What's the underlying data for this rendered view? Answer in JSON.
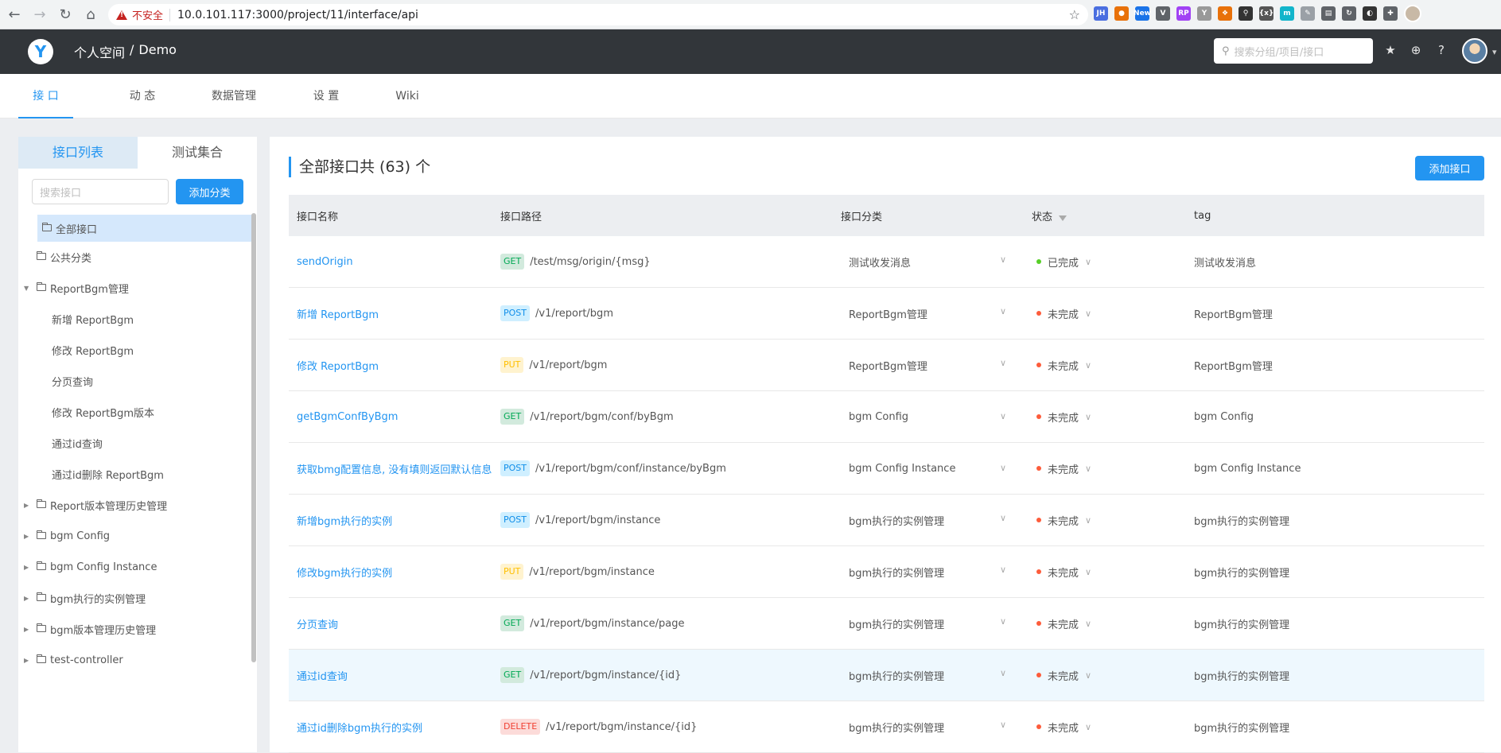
{
  "browser": {
    "insecure_label": "不安全",
    "url": "10.0.101.117:3000/project/11/interface/api",
    "extensions": [
      "JH",
      "●",
      "New",
      "V",
      "RP",
      "Y",
      "❖",
      "⚲",
      "{x}",
      "m",
      "✎",
      "▤",
      "↻",
      "◐",
      "✚"
    ]
  },
  "header": {
    "breadcrumb_space": "个人空间",
    "breadcrumb_sep": "/",
    "breadcrumb_project": "Demo",
    "search_placeholder": "搜索分组/项目/接口"
  },
  "subnav": {
    "tabs": [
      "接 口",
      "动 态",
      "数据管理",
      "设 置",
      "Wiki"
    ]
  },
  "left": {
    "tab_list": "接口列表",
    "tab_test": "测试集合",
    "search_placeholder": "搜索接口",
    "add_category": "添加分类",
    "tree": [
      {
        "label": "全部接口",
        "type": "folder",
        "selected": true
      },
      {
        "label": "公共分类",
        "type": "folder"
      },
      {
        "label": "ReportBgm管理",
        "type": "folder",
        "expanded": true
      },
      {
        "label": "新增 ReportBgm",
        "type": "item"
      },
      {
        "label": "修改 ReportBgm",
        "type": "item"
      },
      {
        "label": "分页查询",
        "type": "item"
      },
      {
        "label": "修改 ReportBgm版本",
        "type": "item"
      },
      {
        "label": "通过id查询",
        "type": "item"
      },
      {
        "label": "通过id删除 ReportBgm",
        "type": "item"
      },
      {
        "label": "Report版本管理历史管理",
        "type": "folder",
        "collapsed": true
      },
      {
        "label": "bgm Config",
        "type": "folder",
        "collapsed": true
      },
      {
        "label": "bgm Config Instance",
        "type": "folder",
        "collapsed": true
      },
      {
        "label": "bgm执行的实例管理",
        "type": "folder",
        "collapsed": true
      },
      {
        "label": "bgm版本管理历史管理",
        "type": "folder",
        "collapsed": true
      },
      {
        "label": "test-controller",
        "type": "folder",
        "collapsed": true
      }
    ]
  },
  "main": {
    "title": "全部接口共 (63) 个",
    "add_api": "添加接口",
    "columns": [
      "接口名称",
      "接口路径",
      "接口分类",
      "状态",
      "tag"
    ],
    "status_colors": {
      "done": "#57cf27",
      "todo": "#fd5c3b"
    },
    "rows": [
      {
        "name": "sendOrigin",
        "method": "GET",
        "path": "/test/msg/origin/{msg}",
        "category": "测试收发消息",
        "status": "已完成",
        "done": true,
        "tag": "测试收发消息"
      },
      {
        "name": "新增 ReportBgm",
        "method": "POST",
        "path": "/v1/report/bgm",
        "category": "ReportBgm管理",
        "status": "未完成",
        "done": false,
        "tag": "ReportBgm管理"
      },
      {
        "name": "修改 ReportBgm",
        "method": "PUT",
        "path": "/v1/report/bgm",
        "category": "ReportBgm管理",
        "status": "未完成",
        "done": false,
        "tag": "ReportBgm管理"
      },
      {
        "name": "getBgmConfByBgm",
        "method": "GET",
        "path": "/v1/report/bgm/conf/byBgm",
        "category": "bgm Config",
        "status": "未完成",
        "done": false,
        "tag": "bgm Config"
      },
      {
        "name": "获取bmg配置信息, 没有填则返回默认信息",
        "method": "POST",
        "path": "/v1/report/bgm/conf/instance/byBgm",
        "category": "bgm Config Instance",
        "status": "未完成",
        "done": false,
        "tag": "bgm Config Instance"
      },
      {
        "name": "新增bgm执行的实例",
        "method": "POST",
        "path": "/v1/report/bgm/instance",
        "category": "bgm执行的实例管理",
        "status": "未完成",
        "done": false,
        "tag": "bgm执行的实例管理"
      },
      {
        "name": "修改bgm执行的实例",
        "method": "PUT",
        "path": "/v1/report/bgm/instance",
        "category": "bgm执行的实例管理",
        "status": "未完成",
        "done": false,
        "tag": "bgm执行的实例管理"
      },
      {
        "name": "分页查询",
        "method": "GET",
        "path": "/v1/report/bgm/instance/page",
        "category": "bgm执行的实例管理",
        "status": "未完成",
        "done": false,
        "tag": "bgm执行的实例管理"
      },
      {
        "name": "通过id查询",
        "method": "GET",
        "path": "/v1/report/bgm/instance/{id}",
        "category": "bgm执行的实例管理",
        "status": "未完成",
        "done": false,
        "tag": "bgm执行的实例管理",
        "highlight": true
      },
      {
        "name": "通过id删除bgm执行的实例",
        "method": "DELETE",
        "path": "/v1/report/bgm/instance/{id}",
        "category": "bgm执行的实例管理",
        "status": "未完成",
        "done": false,
        "tag": "bgm执行的实例管理"
      }
    ]
  }
}
